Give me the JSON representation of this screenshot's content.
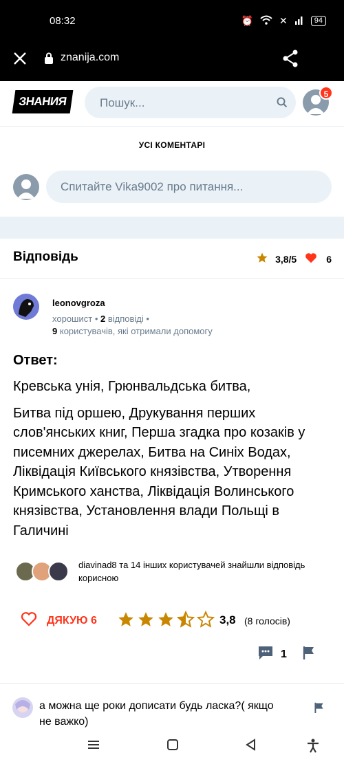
{
  "status": {
    "time": "08:32",
    "battery": "94"
  },
  "browser": {
    "url": "znanija.com"
  },
  "site": {
    "logo": "ЗНАНИЯ",
    "search_placeholder": "Пошук...",
    "notifications": "5"
  },
  "comments": {
    "title": "УСІ КОМЕНТАРІ",
    "ask_placeholder": "Спитайте Vika9002 про питання..."
  },
  "answer": {
    "heading": "Відповідь",
    "rating": "3,8/5",
    "likes": "6",
    "author": {
      "name": "leonovgroza",
      "rank": "хорошист",
      "answers": "2",
      "answers_label": "відповіді",
      "helped_count": "9",
      "helped_label": "користувачів, які отримали допомогу"
    },
    "label": "Ответ:",
    "paragraph1": "Кревська унія, Грюнвальдська битва,",
    "paragraph2": "Битва під оршею, Друкування перших слов'янських книг, Перша згадка про козаків у писемних джерелах, Битва на Синіх Водах, Ліквідація Київського князівства, Утворення Кримського ханства, Ліквідація Волинського князівства, Установлення влади Польщі в Галичині",
    "helpful_text": "diavinad8 та 14 інших користувачей знайшли відповідь корисною",
    "thanks_label": "ДЯКУЮ 6",
    "score": "3,8",
    "votes": "(8 голосів)",
    "stars_value": 3.5,
    "comment_count": "1"
  },
  "comment": {
    "text": "а можна ще роки дописати будь ласка?( якщо не важко)"
  },
  "colors": {
    "accent_red": "#ff341a",
    "star": "#fbbe2e",
    "search_bg": "#ebf2f7",
    "muted": "#687b8c"
  }
}
